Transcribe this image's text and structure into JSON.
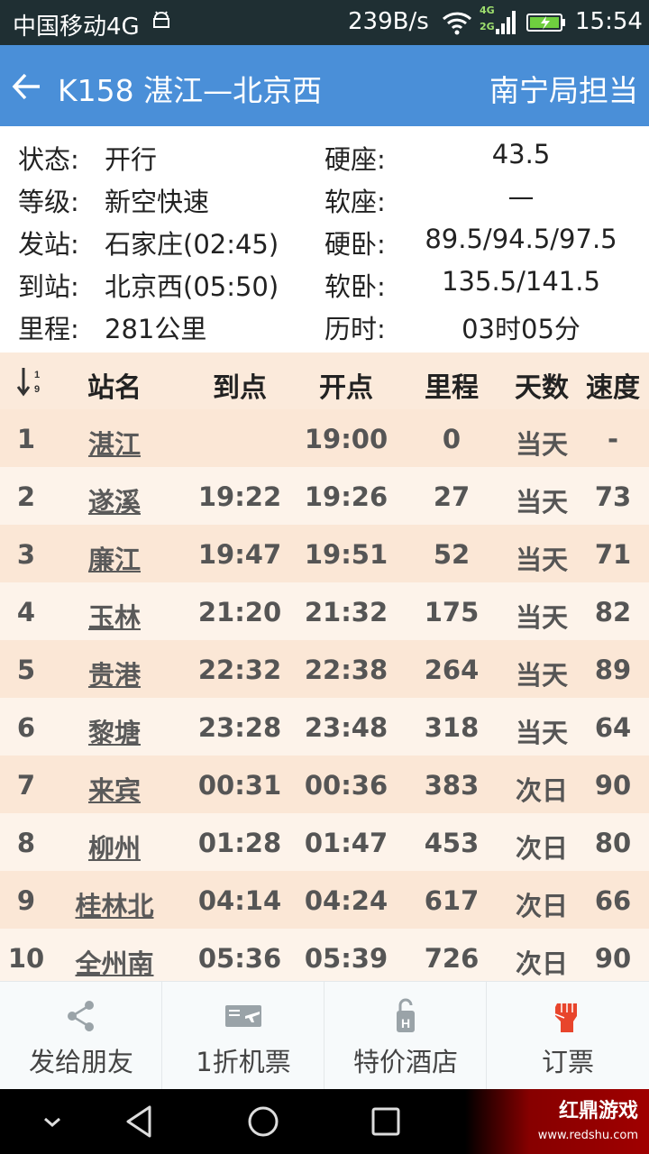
{
  "status_bar": {
    "carrier": "中国移动4G",
    "speed": "239B/s",
    "net_type_top": "4G",
    "net_type_bottom": "2G",
    "time": "15:54",
    "icons": [
      "android-icon",
      "wifi-icon",
      "signal-icon",
      "battery-charging-icon"
    ]
  },
  "header": {
    "back_icon": "arrow-left-icon",
    "title": "K158 湛江—北京西",
    "bureau": "南宁局担当"
  },
  "info": {
    "left": [
      {
        "label": "状态:",
        "value": "开行"
      },
      {
        "label": "等级:",
        "value": "新空快速"
      },
      {
        "label": "发站:",
        "value": "石家庄(02:45)"
      },
      {
        "label": "到站:",
        "value": "北京西(05:50)"
      },
      {
        "label": "里程:",
        "value": "281公里"
      }
    ],
    "right": [
      {
        "label": "硬座:",
        "value": "43.5"
      },
      {
        "label": "软座:",
        "value": "—"
      },
      {
        "label": "硬卧:",
        "value": "89.5/94.5/97.5"
      },
      {
        "label": "软卧:",
        "value": "135.5/141.5"
      },
      {
        "label": "历时:",
        "value": "03时05分"
      }
    ]
  },
  "table": {
    "sort_icon": "sort-ascending-icon",
    "headers": [
      "站名",
      "到点",
      "开点",
      "里程",
      "天数",
      "速度"
    ],
    "rows": [
      {
        "no": "1",
        "station": "湛江",
        "arrive": "",
        "depart": "19:00",
        "km": "0",
        "day": "当天",
        "speed": "-"
      },
      {
        "no": "2",
        "station": "遂溪",
        "arrive": "19:22",
        "depart": "19:26",
        "km": "27",
        "day": "当天",
        "speed": "73"
      },
      {
        "no": "3",
        "station": "廉江",
        "arrive": "19:47",
        "depart": "19:51",
        "km": "52",
        "day": "当天",
        "speed": "71"
      },
      {
        "no": "4",
        "station": "玉林",
        "arrive": "21:20",
        "depart": "21:32",
        "km": "175",
        "day": "当天",
        "speed": "82"
      },
      {
        "no": "5",
        "station": "贵港",
        "arrive": "22:32",
        "depart": "22:38",
        "km": "264",
        "day": "当天",
        "speed": "89"
      },
      {
        "no": "6",
        "station": "黎塘",
        "arrive": "23:28",
        "depart": "23:48",
        "km": "318",
        "day": "当天",
        "speed": "64"
      },
      {
        "no": "7",
        "station": "来宾",
        "arrive": "00:31",
        "depart": "00:36",
        "km": "383",
        "day": "次日",
        "speed": "90"
      },
      {
        "no": "8",
        "station": "柳州",
        "arrive": "01:28",
        "depart": "01:47",
        "km": "453",
        "day": "次日",
        "speed": "80"
      },
      {
        "no": "9",
        "station": "桂林北",
        "arrive": "04:14",
        "depart": "04:24",
        "km": "617",
        "day": "次日",
        "speed": "66"
      },
      {
        "no": "10",
        "station": "全州南",
        "arrive": "05:36",
        "depart": "05:39",
        "km": "726",
        "day": "次日",
        "speed": "90"
      }
    ]
  },
  "actions": [
    {
      "label": "发给朋友",
      "icon": "share-icon"
    },
    {
      "label": "1折机票",
      "icon": "flight-ticket-icon"
    },
    {
      "label": "特价酒店",
      "icon": "hotel-icon"
    },
    {
      "label": "订票",
      "icon": "fist-icon"
    }
  ],
  "nav_bar": {
    "icons": [
      "chevron-down-icon",
      "back-triangle-icon",
      "home-circle-icon",
      "recents-square-icon"
    ]
  },
  "watermark": {
    "text": "红鼎游戏",
    "url": "www.redshu.com"
  },
  "colors": {
    "header": "#4a8fd8",
    "row_odd": "#fbe7d6",
    "row_even": "#fdf3ea",
    "fist_red": "#e8452c"
  }
}
